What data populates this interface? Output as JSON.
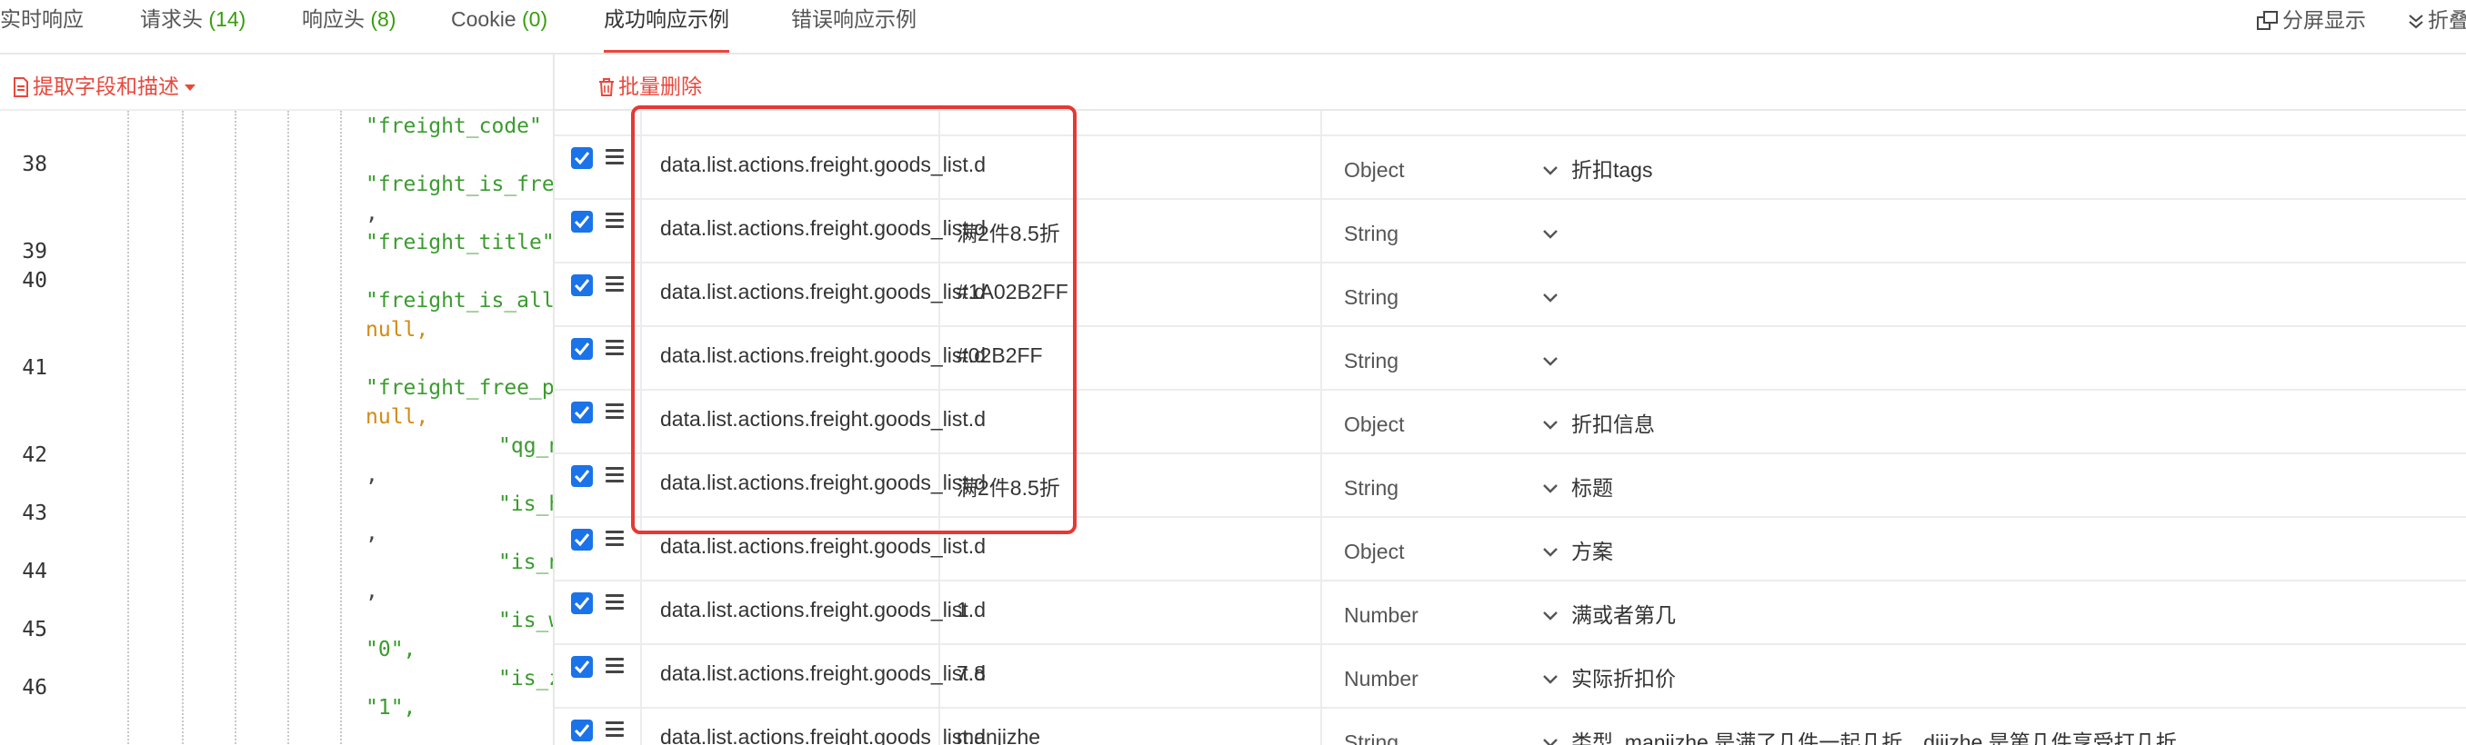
{
  "tabs": [
    {
      "label": "实时响应",
      "count": ""
    },
    {
      "label": "请求头",
      "count": "(14)"
    },
    {
      "label": "响应头",
      "count": "(8)"
    },
    {
      "label": "Cookie",
      "count": "(0)"
    },
    {
      "label": "成功响应示例",
      "count": ""
    },
    {
      "label": "错误响应示例",
      "count": ""
    }
  ],
  "active_tab": "成功响应示例",
  "toolbar_right": {
    "split_view": "分屏显示",
    "collapse": "折叠"
  },
  "left_panel": {
    "extract_label": "提取字段和描述",
    "code_lines": [
      {
        "no": "",
        "text": "\"freight_code\"",
        "kind": "str",
        "indent": 1
      },
      {
        "no": "38",
        "text": "",
        "kind": "str",
        "indent": 1
      },
      {
        "no": "",
        "text": "\"freight_is_fre",
        "kind": "str",
        "indent": 1
      },
      {
        "no": "",
        "text": ",",
        "kind": "punc",
        "indent": 1
      },
      {
        "no": "39",
        "text": "\"freight_title\"",
        "kind": "str",
        "indent": 1
      },
      {
        "no": "40",
        "text": "",
        "kind": "str",
        "indent": 1
      },
      {
        "no": "",
        "text": "\"freight_is_all",
        "kind": "str",
        "indent": 1
      },
      {
        "no": "",
        "text": "null,",
        "kind": "nul",
        "indent": 1
      },
      {
        "no": "41",
        "text": "",
        "kind": "str",
        "indent": 1
      },
      {
        "no": "",
        "text": "\"freight_free_p",
        "kind": "str",
        "indent": 1
      },
      {
        "no": "",
        "text": "null,",
        "kind": "nul",
        "indent": 1
      },
      {
        "no": "42",
        "text": "\"qg_n",
        "kind": "str",
        "indent": 2
      },
      {
        "no": "",
        "text": ",",
        "kind": "punc",
        "indent": 1
      },
      {
        "no": "43",
        "text": "\"is_h",
        "kind": "str",
        "indent": 2
      },
      {
        "no": "",
        "text": ",",
        "kind": "punc",
        "indent": 1
      },
      {
        "no": "44",
        "text": "\"is_n",
        "kind": "str",
        "indent": 2
      },
      {
        "no": "",
        "text": ",",
        "kind": "punc",
        "indent": 1
      },
      {
        "no": "45",
        "text": "\"is_w",
        "kind": "str",
        "indent": 2
      },
      {
        "no": "",
        "text": "\"0\",",
        "kind": "str",
        "indent": 1
      },
      {
        "no": "46",
        "text": "\"is_z",
        "kind": "str",
        "indent": 2
      },
      {
        "no": "",
        "text": "\"1\",",
        "kind": "str",
        "indent": 1
      }
    ]
  },
  "right_panel": {
    "bulk_delete_label": "批量删除",
    "rows": [
      {
        "name": "data.list.actions.freight.goods_list.d",
        "value": "",
        "type": "Object",
        "desc": "折扣tags"
      },
      {
        "name": "data.list.actions.freight.goods_list.d",
        "value": "满2件8.5折",
        "type": "String",
        "desc": ""
      },
      {
        "name": "data.list.actions.freight.goods_list.d",
        "value": "#1A02B2FF",
        "type": "String",
        "desc": ""
      },
      {
        "name": "data.list.actions.freight.goods_list.d",
        "value": "#02B2FF",
        "type": "String",
        "desc": ""
      },
      {
        "name": "data.list.actions.freight.goods_list.d",
        "value": "",
        "type": "Object",
        "desc": "折扣信息"
      },
      {
        "name": "data.list.actions.freight.goods_list.d",
        "value": "满2件8.5折",
        "type": "String",
        "desc": "标题"
      },
      {
        "name": "data.list.actions.freight.goods_list.d",
        "value": "",
        "type": "Object",
        "desc": "方案"
      },
      {
        "name": "data.list.actions.freight.goods_list.d",
        "value": "1",
        "type": "Number",
        "desc": "满或者第几"
      },
      {
        "name": "data.list.actions.freight.goods_list.d",
        "value": "7.8",
        "type": "Number",
        "desc": "实际折扣价"
      },
      {
        "name": "data.list.actions.freight.goods_list.d",
        "value": "manjizhe",
        "type": "String",
        "desc": "类型, manjizhe 是满了几件一起几折，dijizhe 是第几件享受打几折"
      }
    ]
  },
  "colors": {
    "accent": "#e8483c",
    "checkbox": "#1a73e8",
    "highlight": "#e53935",
    "string": "#3a9c2e",
    "null": "#d48a15"
  }
}
